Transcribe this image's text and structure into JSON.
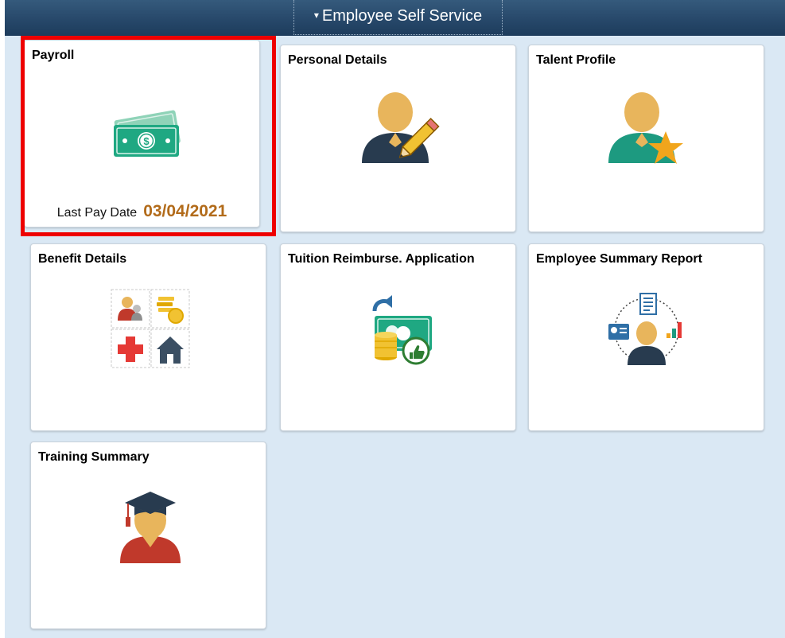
{
  "header": {
    "title": "Employee Self Service",
    "caret": "▾"
  },
  "tiles": [
    {
      "title": "Payroll",
      "icon": "money-icon",
      "pay_date_label": "Last Pay Date",
      "pay_date_value": "03/04/2021",
      "highlighted": true
    },
    {
      "title": "Personal Details",
      "icon": "person-edit-icon"
    },
    {
      "title": "Talent Profile",
      "icon": "person-star-icon"
    },
    {
      "title": "Benefit Details",
      "icon": "benefits-grid-icon"
    },
    {
      "title": "Tuition Reimburse. Application",
      "icon": "tuition-reimburse-icon"
    },
    {
      "title": "Employee Summary Report",
      "icon": "employee-report-icon"
    },
    {
      "title": "Training Summary",
      "icon": "graduate-icon"
    }
  ],
  "colors": {
    "banner": "#27486a",
    "background": "#dae8f4",
    "highlight": "#ee0000",
    "pay_date": "#b26b1a",
    "money_green": "#1fa882",
    "person_skin": "#e8b55c",
    "person_navy": "#283b4f",
    "person_teal": "#1d9a80",
    "star_orange": "#f1a51c",
    "grad_red": "#c0392b"
  }
}
